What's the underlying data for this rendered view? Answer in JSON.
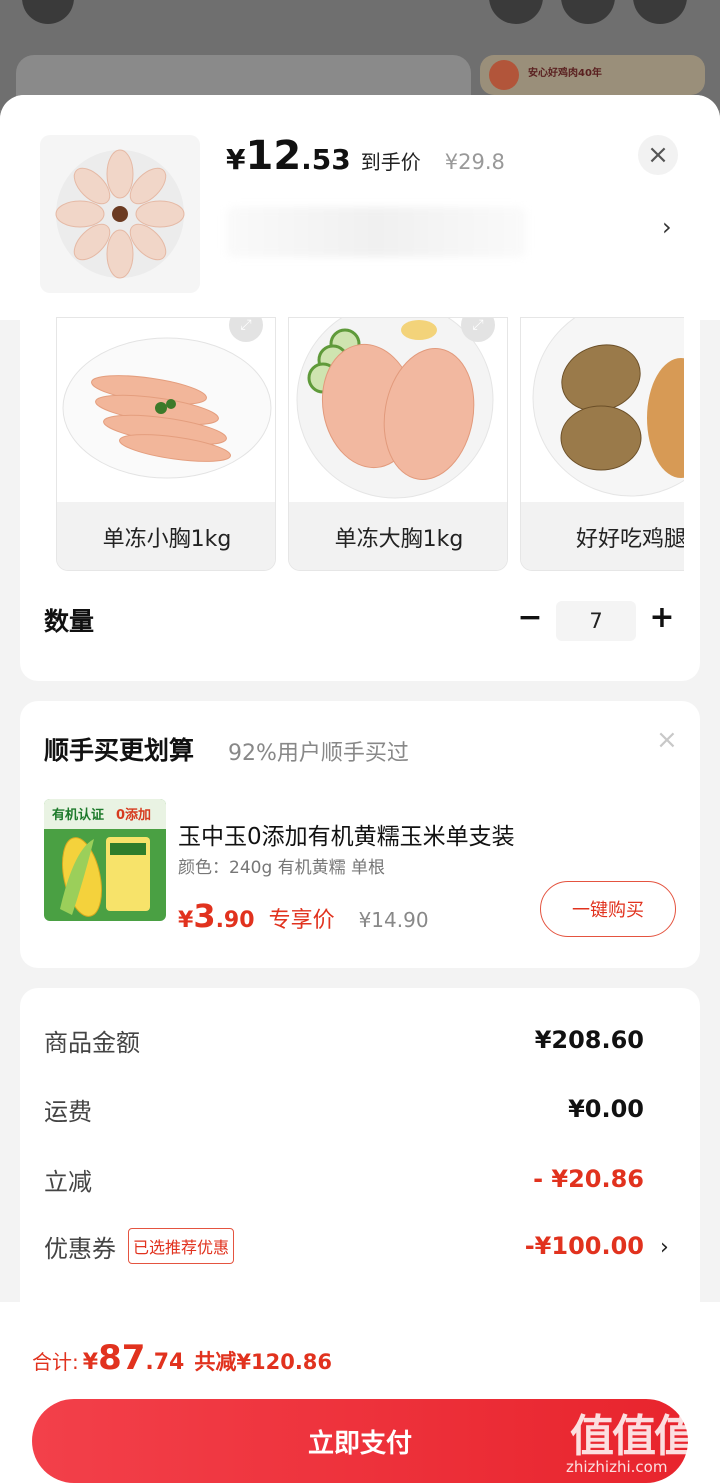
{
  "background": {
    "banner_text": "安心好鸡肉40年"
  },
  "header": {
    "price_symbol": "¥",
    "price_int": "12",
    "price_dec": ".53",
    "price_tag": "到手价",
    "original_price": "¥29.8",
    "close_icon": "×",
    "more_arrow": "›"
  },
  "specs": {
    "items": [
      {
        "label": "单冻小胸1kg"
      },
      {
        "label": "单冻大胸1kg"
      },
      {
        "label": "好好吃鸡腿"
      }
    ]
  },
  "quantity": {
    "label": "数量",
    "minus": "−",
    "value": "7",
    "plus": "+"
  },
  "upsell": {
    "title": "顺手买更划算",
    "subtitle": "92%用户顺手买过",
    "close_icon": "×",
    "product_name": "玉中玉0添加有机黄糯玉米单支装",
    "product_spec": "颜色：240g 有机黄糯 单根",
    "price_symbol": "¥",
    "price_int": "3",
    "price_dec": ".90",
    "price_tag": "专享价",
    "original_price": "¥14.90",
    "buy_button": "一键购买",
    "image_text": {
      "organic": "有机认证",
      "zero": "0添加"
    }
  },
  "summary": {
    "rows": [
      {
        "label": "商品金额",
        "value": "¥208.60"
      },
      {
        "label": "运费",
        "value": "¥0.00"
      },
      {
        "label": "立减",
        "value": "- ¥20.86"
      },
      {
        "label": "优惠券",
        "value": "-¥100.00",
        "badge": "已选推荐优惠"
      }
    ],
    "coupon_arrow": "›"
  },
  "footer": {
    "total_label": "合计:",
    "total_symbol": "¥",
    "total_int": "87",
    "total_dec": ".74",
    "total_save": "共减¥120.86",
    "pay_button": "立即支付"
  },
  "watermark": {
    "logo": "值值值",
    "url": "zhizhizhi.com"
  },
  "colors": {
    "accent": "#e1321e",
    "pay_button": "#ec2a33"
  }
}
